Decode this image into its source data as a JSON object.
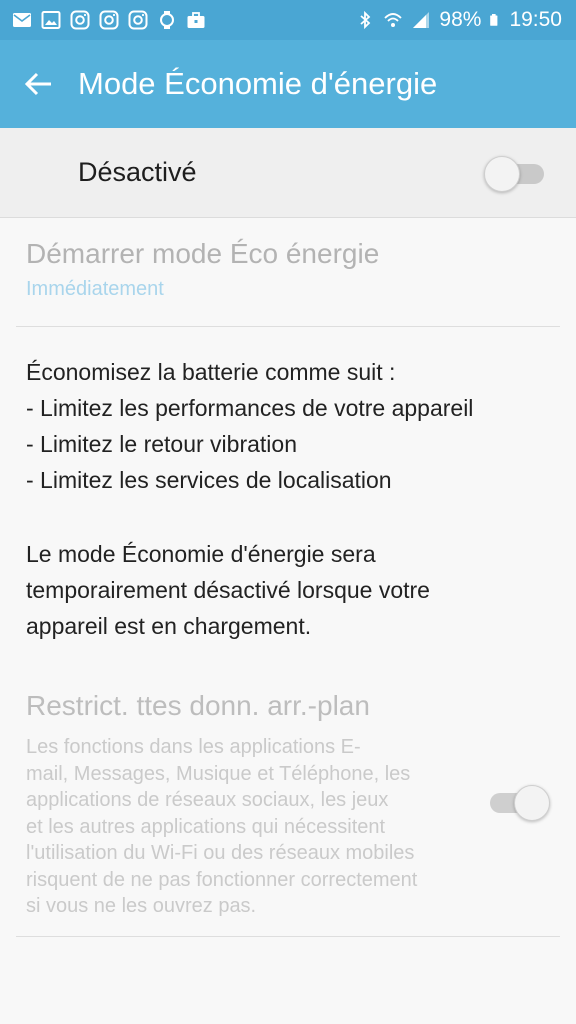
{
  "status_bar": {
    "icons_left": [
      "email-icon",
      "gallery-icon",
      "instagram-icon",
      "instagram-icon",
      "instagram-icon",
      "fitness-icon",
      "briefcase-icon"
    ],
    "battery": "98%",
    "time": "19:50"
  },
  "app_bar": {
    "title": "Mode Économie d'énergie"
  },
  "master_switch": {
    "label": "Désactivé",
    "state": "off"
  },
  "start_setting": {
    "title": "Démarrer mode Éco énergie",
    "value": "Immédiatement"
  },
  "savings_info": {
    "lines": [
      "Économisez la batterie comme suit :",
      "- Limitez les performances de votre appareil",
      "- Limitez le retour vibration",
      "- Limitez les services de localisation"
    ],
    "charging_lines": [
      "Le mode Économie d'énergie sera",
      "temporairement désactivé lorsque votre",
      "appareil est en chargement."
    ]
  },
  "restrict_setting": {
    "title": "Restrict. ttes donn. arr.-plan",
    "description_lines": [
      "Les fonctions dans les applications E-",
      "mail, Messages, Musique et Téléphone, les",
      "applications de réseaux sociaux, les jeux",
      "et les autres applications qui nécessitent",
      "l'utilisation du Wi-Fi ou des réseaux mobiles",
      "risquent de ne pas fonctionner correctement",
      "si vous ne les ouvrez pas."
    ],
    "state": "on"
  },
  "colors": {
    "status_bar": "#4aa6d3",
    "app_bar": "#55b1db",
    "subtitle_blue": "#a9d5ec"
  }
}
